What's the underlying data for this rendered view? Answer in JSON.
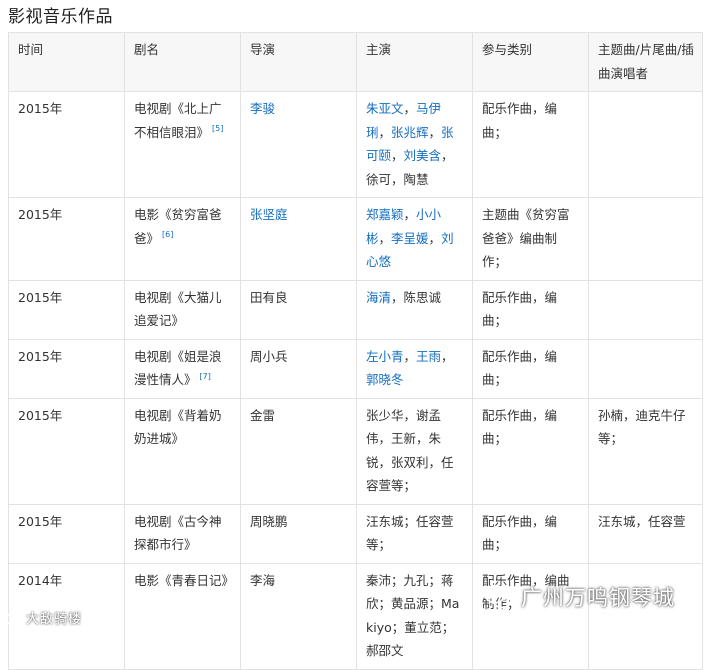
{
  "title": "影视音乐作品",
  "headers": [
    "时间",
    "剧名",
    "导演",
    "主演",
    "参与类别",
    "主题曲/片尾曲/插曲演唱者"
  ],
  "rows": [
    {
      "year": "2015年",
      "drama": {
        "text": "电视剧《北上广不相信眼泪》",
        "ref": "[5]"
      },
      "director": {
        "parts": [
          {
            "text": "李骏",
            "link": true
          }
        ]
      },
      "cast": {
        "parts": [
          {
            "text": "朱亚文",
            "link": true
          },
          {
            "text": "，",
            "link": false
          },
          {
            "text": "马伊琍",
            "link": true
          },
          {
            "text": "，",
            "link": false
          },
          {
            "text": "张兆辉",
            "link": true
          },
          {
            "text": "，",
            "link": false
          },
          {
            "text": "张可颐",
            "link": true
          },
          {
            "text": "，",
            "link": false
          },
          {
            "text": "刘美含",
            "link": true
          },
          {
            "text": "，徐可，陶慧",
            "link": false
          }
        ]
      },
      "category": "配乐作曲，编曲；",
      "singers": ""
    },
    {
      "year": "2015年",
      "drama": {
        "text": "电影《贫穷富爸爸》",
        "ref": "[6]"
      },
      "director": {
        "parts": [
          {
            "text": "张坚庭",
            "link": true
          }
        ]
      },
      "cast": {
        "parts": [
          {
            "text": "郑嘉颖",
            "link": true
          },
          {
            "text": "，",
            "link": false
          },
          {
            "text": "小小彬",
            "link": true
          },
          {
            "text": "，",
            "link": false
          },
          {
            "text": "李呈媛",
            "link": true
          },
          {
            "text": "，",
            "link": false
          },
          {
            "text": "刘心悠",
            "link": true
          }
        ]
      },
      "category": "主题曲《贫穷富爸爸》编曲制作；",
      "singers": ""
    },
    {
      "year": "2015年",
      "drama": {
        "text": "电视剧《大猫儿追爱记》",
        "ref": ""
      },
      "director": {
        "parts": [
          {
            "text": "田有良",
            "link": false
          }
        ]
      },
      "cast": {
        "parts": [
          {
            "text": "海清",
            "link": true
          },
          {
            "text": "，陈思诚",
            "link": false
          }
        ]
      },
      "category": "配乐作曲，编曲；",
      "singers": ""
    },
    {
      "year": "2015年",
      "drama": {
        "text": "电视剧《姐是浪漫性情人》",
        "ref": "[7]"
      },
      "director": {
        "parts": [
          {
            "text": "周小兵",
            "link": false
          }
        ]
      },
      "cast": {
        "parts": [
          {
            "text": "左小青",
            "link": true
          },
          {
            "text": "，",
            "link": false
          },
          {
            "text": "王雨",
            "link": true
          },
          {
            "text": "，",
            "link": false
          },
          {
            "text": "郭晓冬",
            "link": true
          }
        ]
      },
      "category": "配乐作曲，编曲；",
      "singers": ""
    },
    {
      "year": "2015年",
      "drama": {
        "text": "电视剧《背着奶奶进城》",
        "ref": ""
      },
      "director": {
        "parts": [
          {
            "text": "金雷",
            "link": false
          }
        ]
      },
      "cast": {
        "parts": [
          {
            "text": "张少华，谢孟伟，王新，朱锐，张双利，任容萱等；",
            "link": false
          }
        ]
      },
      "category": "配乐作曲，编曲；",
      "singers": "孙楠，迪克牛仔等；"
    },
    {
      "year": "2015年",
      "drama": {
        "text": "电视剧《古今神探都市行》",
        "ref": ""
      },
      "director": {
        "parts": [
          {
            "text": "周晓鹏",
            "link": false
          }
        ]
      },
      "cast": {
        "parts": [
          {
            "text": "汪东城；任容萱等；",
            "link": false
          }
        ]
      },
      "category": "配乐作曲，编曲；",
      "singers": "汪东城，任容萱"
    },
    {
      "year": "2014年",
      "drama": {
        "text": "电影《青春日记》",
        "ref": ""
      },
      "director": {
        "parts": [
          {
            "text": "李海",
            "link": false
          }
        ]
      },
      "cast": {
        "parts": [
          {
            "text": "秦沛；九孔；蒋欣；黄品源；Makiyo；董立范；郝邵文",
            "link": false
          }
        ]
      },
      "category": "配乐作曲，编曲制作；",
      "singers": ""
    }
  ],
  "watermarks": {
    "right_text": "广州万鸣钢琴城",
    "right_icon": "wechat-icon",
    "left_text": "大敌骑楼",
    "left_icon": "weibo-icon"
  }
}
